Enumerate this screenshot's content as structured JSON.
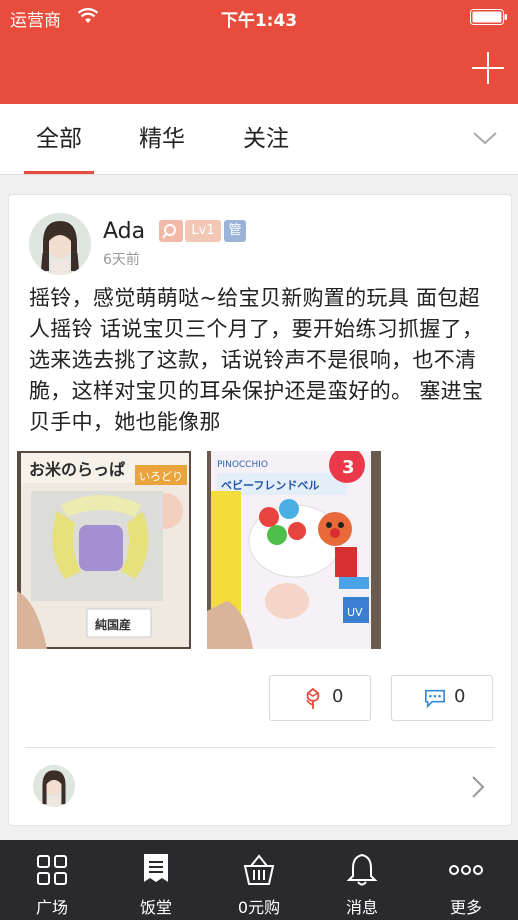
{
  "status_bar": {
    "carrier": "运营商",
    "time": "下午1:43"
  },
  "tabs": [
    {
      "label": "全部",
      "active": true
    },
    {
      "label": "精华",
      "active": false
    },
    {
      "label": "关注",
      "active": false
    }
  ],
  "post": {
    "author": "Ada",
    "level_badge": "Lv1",
    "admin_badge": "管",
    "time": "6天前",
    "text": "摇铃，感觉萌萌哒~给宝贝新购置的玩具 面包超人摇铃 话说宝贝三个月了，要开始练习抓握了，选来选去挑了这款，话说铃声不是很响，也不清脆，这样对宝贝的耳朵保护还是蛮好的。 塞进宝贝手中，她也能像那",
    "likes": "0",
    "comments": "0",
    "photos": [
      {
        "name": "rice-rattle-photo",
        "title_text": "お米のらっぱ",
        "tag_text": "いろどり",
        "label_text": "純国産"
      },
      {
        "name": "anpanman-bell-photo",
        "brand_text": "PINOCCHIO",
        "title_text": "ベビーフレンドベル",
        "badge_text": "3",
        "uv_text": "UV"
      }
    ]
  },
  "bottom_nav": [
    {
      "label": "广场",
      "icon": "grid-icon"
    },
    {
      "label": "饭堂",
      "icon": "document-icon"
    },
    {
      "label": "0元购",
      "icon": "basket-icon"
    },
    {
      "label": "消息",
      "icon": "bell-icon"
    },
    {
      "label": "更多",
      "icon": "more-icon"
    }
  ],
  "colors": {
    "accent": "#e84c3d",
    "nav_bg": "#2a2a2e"
  }
}
